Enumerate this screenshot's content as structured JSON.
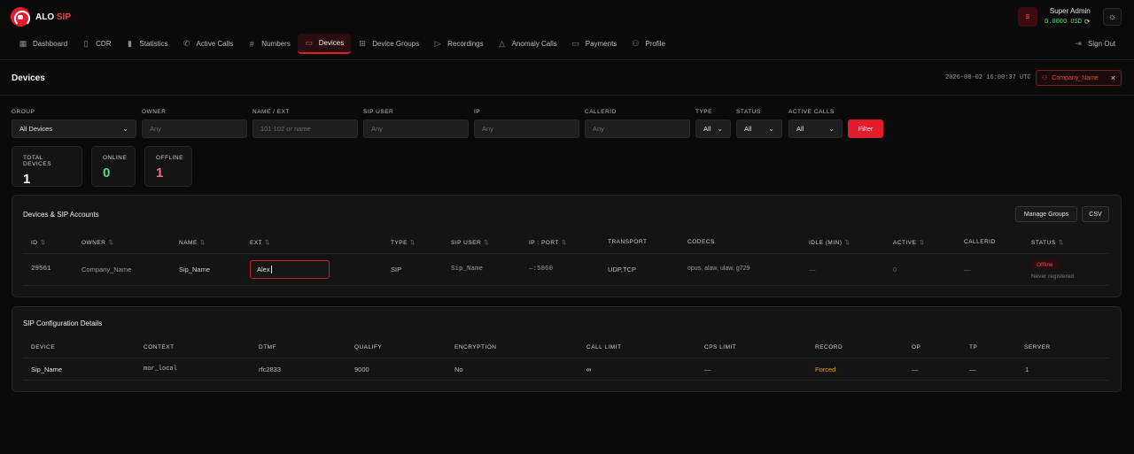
{
  "brand": {
    "name": "ALO",
    "accent": "SIP"
  },
  "user": {
    "initial": "S",
    "name": "Super Admin",
    "balance": "0.0000 USD"
  },
  "nav": {
    "items": [
      {
        "label": "Dashboard",
        "icon": "grid-icon"
      },
      {
        "label": "CDR",
        "icon": "document-icon"
      },
      {
        "label": "Statistics",
        "icon": "bar-chart-icon"
      },
      {
        "label": "Active Calls",
        "icon": "phone-icon"
      },
      {
        "label": "Numbers",
        "icon": "hash-icon"
      },
      {
        "label": "Devices",
        "icon": "monitor-icon"
      },
      {
        "label": "Device Groups",
        "icon": "layout-icon"
      },
      {
        "label": "Recordings",
        "icon": "play-circle-icon"
      },
      {
        "label": "Anomaly Calls",
        "icon": "warning-triangle-icon"
      },
      {
        "label": "Payments",
        "icon": "credit-card-icon"
      },
      {
        "label": "Profile",
        "icon": "user-icon"
      }
    ],
    "active": "Devices",
    "signout": "Sign Out"
  },
  "page": {
    "title": "Devices",
    "timestamp": "2026-08-02 16:00:37 UTC",
    "company_filter": "Company_Name"
  },
  "filters": {
    "group": {
      "label": "GROUP",
      "value": "All Devices"
    },
    "owner": {
      "label": "OWNER",
      "placeholder": "Any"
    },
    "name_ext": {
      "label": "NAME / EXT",
      "placeholder": "101 102 or name"
    },
    "sip_user": {
      "label": "SIP USER",
      "placeholder": "Any"
    },
    "ip": {
      "label": "IP",
      "placeholder": "Any"
    },
    "callerid": {
      "label": "CALLERID",
      "placeholder": "Any"
    },
    "type": {
      "label": "TYPE",
      "value": "All"
    },
    "status": {
      "label": "STATUS",
      "value": "All"
    },
    "active_calls": {
      "label": "ACTIVE CALLS",
      "value": "All"
    },
    "button": "Filter"
  },
  "stats": {
    "total": {
      "label": "TOTAL DEVICES",
      "value": "1"
    },
    "online": {
      "label": "ONLINE",
      "value": "0"
    },
    "offline": {
      "label": "OFFLINE",
      "value": "1"
    }
  },
  "devices_panel": {
    "title": "Devices & SIP Accounts",
    "manage_groups": "Manage Groups",
    "csv": "CSV",
    "columns": [
      "ID",
      "OWNER",
      "NAME",
      "EXT",
      "TYPE",
      "SIP USER",
      "IP : PORT",
      "TRANSPORT",
      "CODECS",
      "IDLE (MIN)",
      "ACTIVE",
      "CALLERID",
      "STATUS"
    ],
    "sort_icon": "⇅",
    "row": {
      "id": "29561",
      "owner": "Company_Name",
      "name": "Sip_Name",
      "ext": "Alex",
      "type": "SIP",
      "sip_user": "Sip_Name",
      "ip_port": "—:5060",
      "transport": "UDP,TCP",
      "codecs": "opus, alaw, ulaw, g729",
      "idle": "—",
      "active": "0",
      "callerid": "—",
      "status": "Offline",
      "status_note": "Never registered"
    }
  },
  "sip_panel": {
    "title": "SIP Configuration Details",
    "columns": [
      "DEVICE",
      "CONTEXT",
      "DTMF",
      "QUALIFY",
      "ENCRYPTION",
      "CALL LIMIT",
      "CPS LIMIT",
      "RECORD",
      "OP",
      "TP",
      "SERVER"
    ],
    "row": {
      "device": "Sip_Name",
      "context": "mor_local",
      "dtmf": "rfc2833",
      "qualify": "9000",
      "encryption": "No",
      "call_limit": "∞",
      "cps_limit": "—",
      "record": "Forced",
      "op": "—",
      "tp": "—",
      "server": "1"
    }
  },
  "colors": {
    "accent": "#e11d2b",
    "online": "#4ade80",
    "offline": "#f87171",
    "record_forced": "#f59e0b"
  }
}
